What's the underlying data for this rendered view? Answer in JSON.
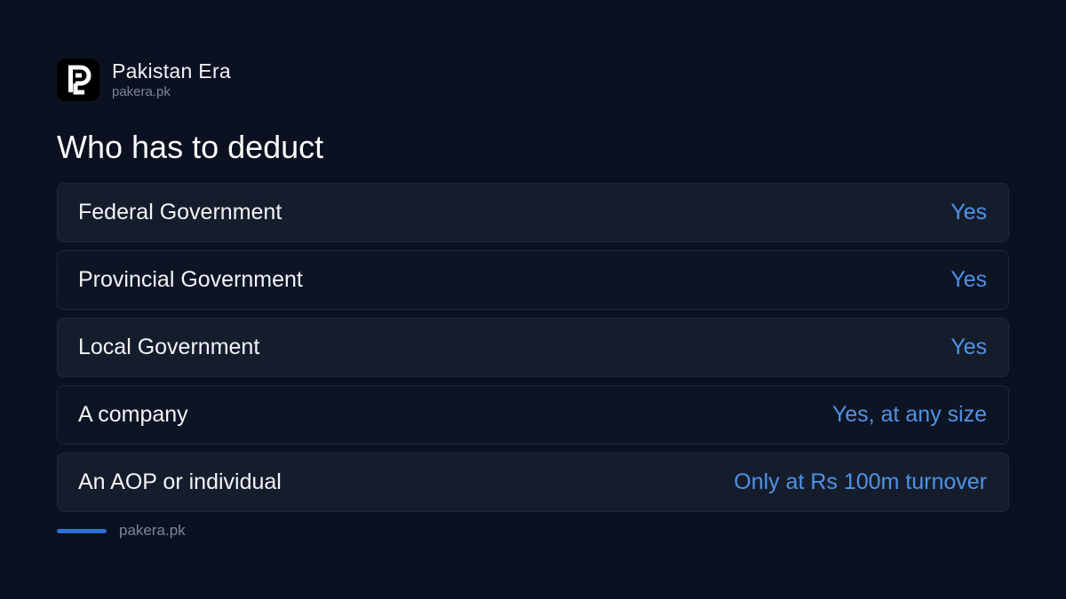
{
  "brand": {
    "name": "Pakistan Era",
    "domain": "pakera.pk",
    "logo_icon": "pakera-logo-icon"
  },
  "heading": "Who has to deduct",
  "rows": [
    {
      "label": "Federal Government",
      "value": "Yes"
    },
    {
      "label": "Provincial Government",
      "value": "Yes"
    },
    {
      "label": "Local Government",
      "value": "Yes"
    },
    {
      "label": "A company",
      "value": "Yes, at any size"
    },
    {
      "label": "An AOP or individual",
      "value": "Only at Rs 100m turnover"
    }
  ],
  "footer": {
    "text": "pakera.pk"
  },
  "colors": {
    "background": "#0b1120",
    "accent": "#4f93e6",
    "footer_bar": "#2f6fd6"
  }
}
